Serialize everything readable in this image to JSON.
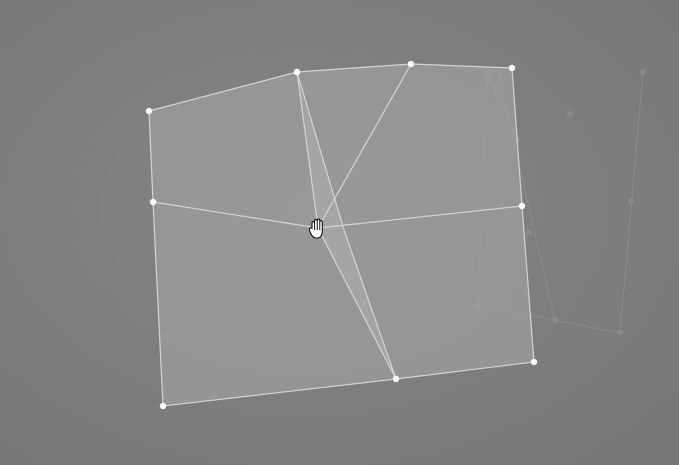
{
  "canvas": {
    "background_color": "#808080",
    "background_gradient_inner": "#858585",
    "background_gradient_outer": "#777777"
  },
  "mesh": {
    "fill_color": "#a0a0a0",
    "fill_opacity": 0.7,
    "edge_color": "#d4d4d4",
    "vertex_color": "#ffffff",
    "fold_highlight_color": "#b0b0b0"
  },
  "ghost_mesh": {
    "color": "#9a9a9a",
    "opacity": 0.5
  },
  "cursor": {
    "icon": "grab-hand-cursor-icon",
    "color": "#ffffff",
    "outline_color": "#000000"
  }
}
